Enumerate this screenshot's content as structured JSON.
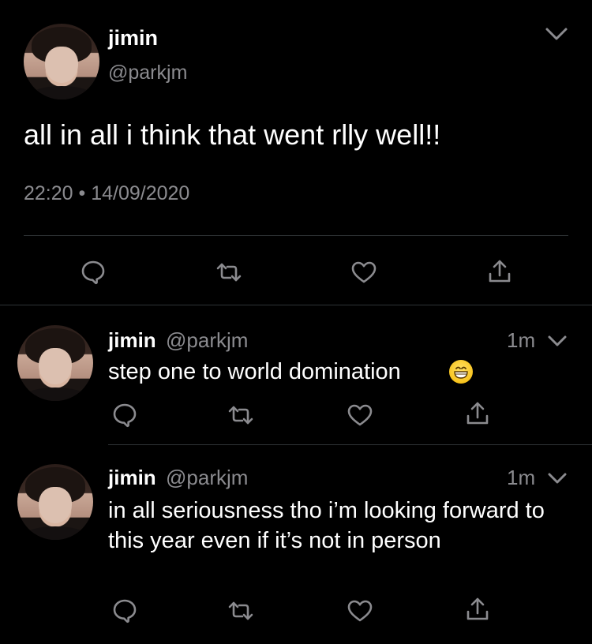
{
  "main_tweet": {
    "author_name": "jimin",
    "author_handle": "@parkjm",
    "text": "all in all i think that went rlly well!!",
    "timestamp": "22:20 • 14/09/2020"
  },
  "replies": [
    {
      "author_name": "jimin",
      "author_handle": "@parkjm",
      "time_ago": "1m",
      "text": "step one to world domination",
      "emoji": "grinning-face-emoji"
    },
    {
      "author_name": "jimin",
      "author_handle": "@parkjm",
      "time_ago": "1m",
      "text": "in all seriousness tho i’m looking forward to this year even if it’s not in person"
    }
  ],
  "icons": {
    "reply": "speech-bubble-icon",
    "retweet": "retweet-icon",
    "like": "heart-icon",
    "share": "share-icon",
    "more": "chevron-down-icon"
  },
  "colors": {
    "background": "#000000",
    "text": "#ffffff",
    "secondary_text": "#8b8b8f",
    "divider": "#2f3336",
    "icon": "#8b8b8f"
  }
}
